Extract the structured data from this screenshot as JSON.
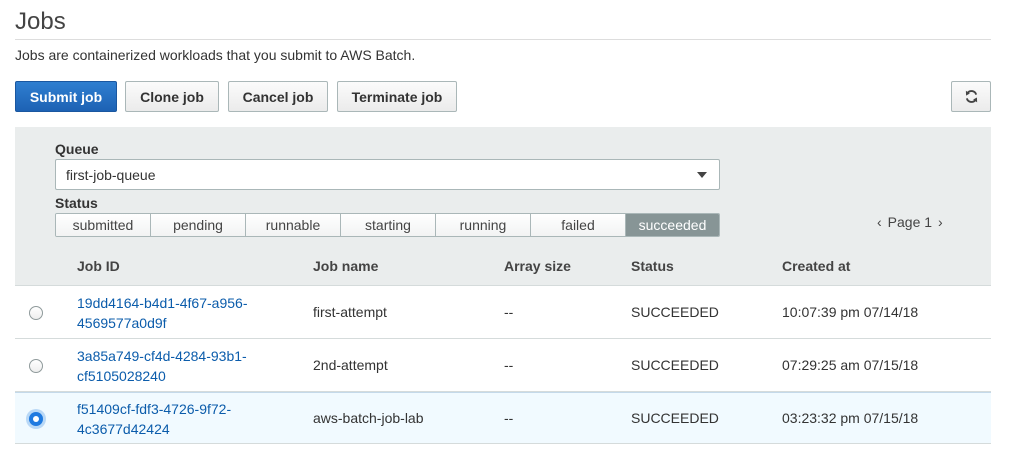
{
  "page": {
    "title": "Jobs",
    "description": "Jobs are containerized workloads that you submit to AWS Batch."
  },
  "toolbar": {
    "submit_label": "Submit job",
    "clone_label": "Clone job",
    "cancel_label": "Cancel job",
    "terminate_label": "Terminate job",
    "refresh_icon": "refresh-icon",
    "primary_color": "#1f6fc5"
  },
  "filters": {
    "queue_label": "Queue",
    "queue_value": "first-job-queue",
    "status_label": "Status",
    "statuses": [
      "submitted",
      "pending",
      "runnable",
      "starting",
      "running",
      "failed",
      "succeeded"
    ],
    "active_status": "succeeded"
  },
  "pager": {
    "prev": "‹",
    "label": "Page 1",
    "next": "›"
  },
  "table": {
    "columns": [
      "Job ID",
      "Job name",
      "Array size",
      "Status",
      "Created at"
    ],
    "rows": [
      {
        "id_line1": "19dd4164-b4d1-4f67-a956-",
        "id_line2": "4569577a0d9f",
        "name": "first-attempt",
        "array_size": "--",
        "status": "SUCCEEDED",
        "created": "10:07:39 pm 07/14/18",
        "selected": false
      },
      {
        "id_line1": "3a85a749-cf4d-4284-93b1-",
        "id_line2": "cf5105028240",
        "name": "2nd-attempt",
        "array_size": "--",
        "status": "SUCCEEDED",
        "created": "07:29:25 am 07/15/18",
        "selected": false
      },
      {
        "id_line1": "f51409cf-fdf3-4726-9f72-",
        "id_line2": "4c3677d42424",
        "name": "aws-batch-job-lab",
        "array_size": "--",
        "status": "SUCCEEDED",
        "created": "03:23:32 pm 07/15/18",
        "selected": true
      }
    ]
  }
}
